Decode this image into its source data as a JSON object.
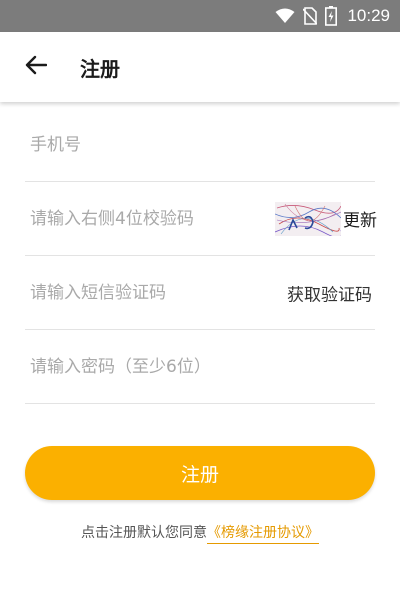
{
  "status_bar": {
    "time": "10:29",
    "icons": [
      "wifi-icon",
      "no-sim-icon",
      "battery-charging-icon"
    ]
  },
  "header": {
    "back_icon": "arrow-left-icon",
    "title": "注册"
  },
  "form": {
    "phone": {
      "placeholder": "手机号",
      "value": ""
    },
    "captcha": {
      "placeholder": "请输入右侧4位校验码",
      "value": "",
      "refresh_label": "更新"
    },
    "sms_code": {
      "placeholder": "请输入短信验证码",
      "value": "",
      "get_code_label": "获取验证码"
    },
    "password": {
      "placeholder": "请输入密码（至少6位）",
      "value": ""
    }
  },
  "register_button": {
    "label": "注册"
  },
  "agreement": {
    "prefix": "点击注册默认您同意",
    "link_text": "《榜缘注册协议》"
  },
  "colors": {
    "accent": "#fbb000",
    "link": "#e59a00",
    "status_bar": "#7c7c7c"
  }
}
